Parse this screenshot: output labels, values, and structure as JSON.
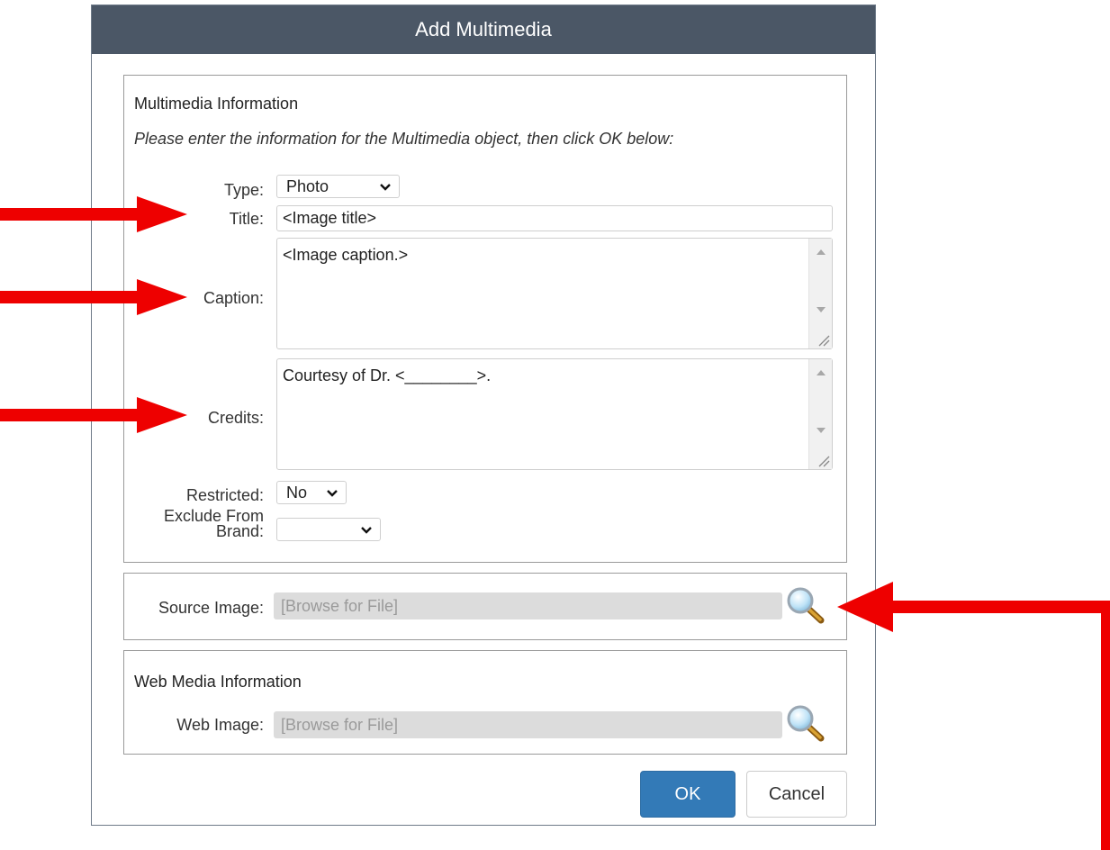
{
  "dialog": {
    "title": "Add Multimedia",
    "ok_label": "OK",
    "cancel_label": "Cancel"
  },
  "info": {
    "heading": "Multimedia Information",
    "instructions": "Please enter the information for the Multimedia object, then click OK below:",
    "type_label": "Type:",
    "type_value": "Photo",
    "title_label": "Title:",
    "title_value": "<Image title>",
    "caption_label": "Caption:",
    "caption_value": "<Image caption.>",
    "credits_label": "Credits:",
    "credits_value": "Courtesy of Dr. <________>.",
    "restricted_label": "Restricted:",
    "restricted_value": "No",
    "exclude_label_line1": "Exclude From",
    "exclude_label_line2": "Brand:",
    "exclude_value": ""
  },
  "source": {
    "label": "Source Image:",
    "placeholder": "[Browse for File]"
  },
  "web": {
    "heading": "Web Media Information",
    "label": "Web Image:",
    "placeholder": "[Browse for File]"
  },
  "icons": {
    "magnifier": "magnifier-icon",
    "chevron": "chevron-down-icon",
    "arrow": "arrow-icon"
  },
  "colors": {
    "titlebar": "#4b5766",
    "primary_button": "#337ab7",
    "annotation_arrow": "#ee0000"
  }
}
